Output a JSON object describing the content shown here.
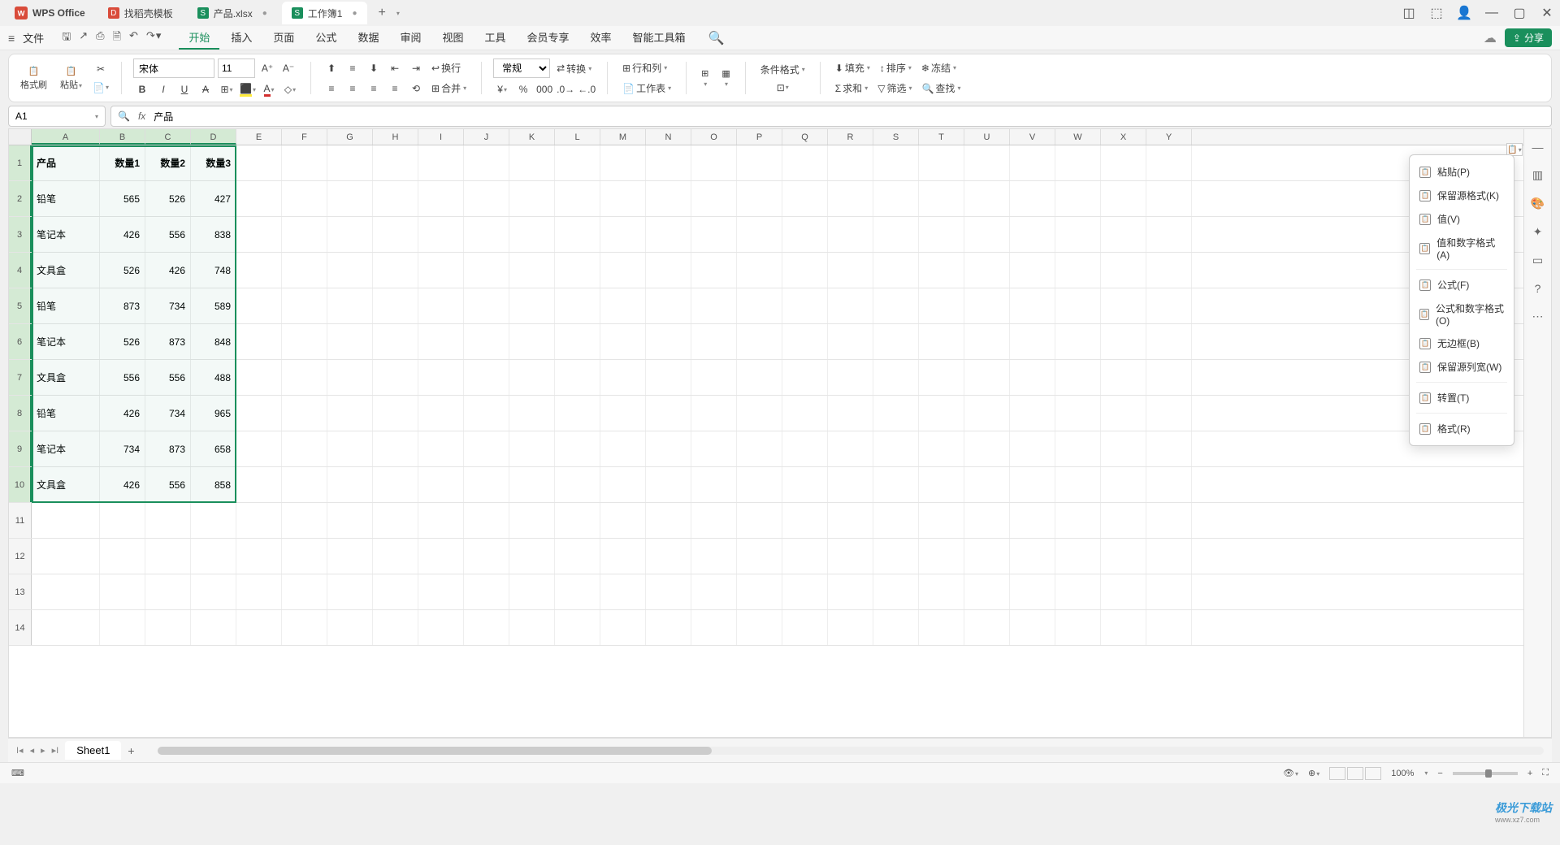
{
  "app": {
    "name": "WPS Office"
  },
  "tabs": [
    {
      "label": "找稻壳模板",
      "iconColor": "#d94b3a",
      "iconText": "D"
    },
    {
      "label": "产品.xlsx",
      "iconColor": "#1a8f5c",
      "iconText": "S",
      "dirty": true
    },
    {
      "label": "工作簿1",
      "iconColor": "#1a8f5c",
      "iconText": "S",
      "active": true,
      "dirty": true
    }
  ],
  "menu": {
    "file": "文件",
    "items": [
      "开始",
      "插入",
      "页面",
      "公式",
      "数据",
      "审阅",
      "视图",
      "工具",
      "会员专享",
      "效率",
      "智能工具箱"
    ],
    "active": 0,
    "share": "分享"
  },
  "ribbon": {
    "formatBrush": "格式刷",
    "paste": "粘贴",
    "font": "宋体",
    "fontSize": "11",
    "merge": "合并",
    "wrap": "换行",
    "numberFormat": "常规",
    "convert": "转换",
    "rowsCols": "行和列",
    "worksheet": "工作表",
    "condFormat": "条件格式",
    "fill": "填充",
    "sort": "排序",
    "freeze": "冻结",
    "sum": "求和",
    "filter": "筛选",
    "find": "查找"
  },
  "nameBox": "A1",
  "formulaValue": "产品",
  "columns": [
    "A",
    "B",
    "C",
    "D",
    "E",
    "F",
    "G",
    "H",
    "I",
    "J",
    "K",
    "L",
    "M",
    "N",
    "O",
    "P",
    "Q",
    "R",
    "S",
    "T",
    "U",
    "V",
    "W",
    "X",
    "Y"
  ],
  "headerRow": [
    "产品",
    "数量1",
    "数量2",
    "数量3"
  ],
  "dataRows": [
    [
      "铅笔",
      "565",
      "526",
      "427"
    ],
    [
      "笔记本",
      "426",
      "556",
      "838"
    ],
    [
      "文具盒",
      "526",
      "426",
      "748"
    ],
    [
      "铅笔",
      "873",
      "734",
      "589"
    ],
    [
      "笔记本",
      "526",
      "873",
      "848"
    ],
    [
      "文具盒",
      "556",
      "556",
      "488"
    ],
    [
      "铅笔",
      "426",
      "734",
      "965"
    ],
    [
      "笔记本",
      "734",
      "873",
      "658"
    ],
    [
      "文具盒",
      "426",
      "556",
      "858"
    ]
  ],
  "pasteOptions": {
    "group1": [
      "粘贴(P)",
      "保留源格式(K)",
      "值(V)",
      "值和数字格式(A)"
    ],
    "group2": [
      "公式(F)",
      "公式和数字格式(O)",
      "无边框(B)",
      "保留源列宽(W)"
    ],
    "group3": [
      "转置(T)"
    ],
    "group4": [
      "格式(R)"
    ]
  },
  "sheetTab": "Sheet1",
  "zoom": "100%",
  "watermark": {
    "brand": "极光下载站",
    "url": "www.xz7.com"
  }
}
